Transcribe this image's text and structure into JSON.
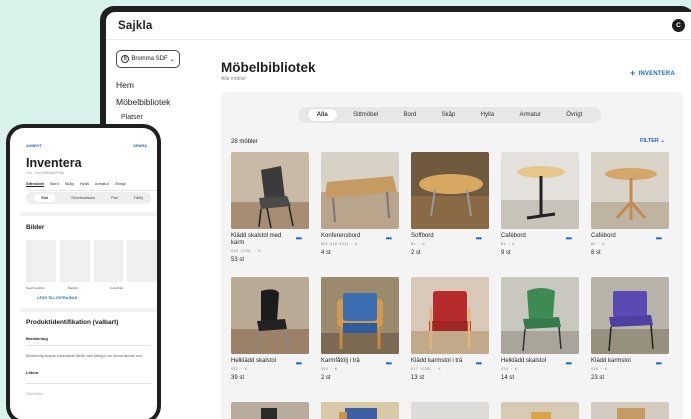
{
  "app": {
    "brand": "Sajkla",
    "avatar_initial": "C"
  },
  "sidebar": {
    "place": "Bromma SDF",
    "place_icon_letter": "B",
    "items": [
      {
        "label": "Hem"
      },
      {
        "label": "Möbelbibliotek"
      },
      {
        "label": "Platser"
      }
    ]
  },
  "main": {
    "title": "Möbelbibliotek",
    "subtitle": "Alla möbler",
    "add_button": "INVENTERA",
    "tabs": [
      "Alla",
      "Sittmöbel",
      "Bord",
      "Skåp",
      "Hylla",
      "Armatur",
      "Övrigt"
    ],
    "active_tab": "Alla",
    "count": "28 möbler",
    "filter": "FILTER"
  },
  "products": [
    {
      "name": "Klädd skalstol med karm",
      "code": "S1S (S29) · K",
      "qty": "53 st"
    },
    {
      "name": "Konferensbord",
      "code": "KO1-416-4311 · K",
      "qty": "4 st"
    },
    {
      "name": "Soffbord",
      "code": "B1 · K",
      "qty": "2 st"
    },
    {
      "name": "Cafébord",
      "code": "B1 · K",
      "qty": "9 st"
    },
    {
      "name": "Cafébord",
      "code": "B1 · K",
      "qty": "8 st"
    },
    {
      "name": "Helklädd skalstol",
      "code": "S52 · K",
      "qty": "39 st"
    },
    {
      "name": "Karmfåtölj i trä",
      "code": "S53 · K",
      "qty": "2 st"
    },
    {
      "name": "Klädd karmstol i trä",
      "code": "S17 (S18) · K",
      "qty": "13 st"
    },
    {
      "name": "Helklädd skalstol",
      "code": "S24 · K",
      "qty": "14 st"
    },
    {
      "name": "Klädd karmstol",
      "code": "S28 · K",
      "qty": "23 st"
    }
  ],
  "phone": {
    "cancel": "AVBRYT",
    "save": "SPARA",
    "title": "Inventera",
    "id": "inv_c5a1906ab09f8a",
    "tabs": [
      "Sittmöbel",
      "Bord",
      "Skåp",
      "Hylla",
      "Armatur",
      "Övrigt"
    ],
    "segments": [
      "Stol",
      "Skrivbordsstol",
      "Pall",
      "Fåtölj"
    ],
    "images_header": "Bilder",
    "image_labels": [
      "Snett framifrån",
      "Bakifrån",
      "Underifrån"
    ],
    "add_image": "LÄGG TILL EXTRA BILD",
    "product_header": "Produktidentifikation (valbart)",
    "naming_label": "Benämning",
    "naming_note": "Benämning skapas automatiskt utifrån vald kategori om denna lämnas tom.",
    "brand_label": "Littera",
    "maker_placeholder": "Tillverkare"
  },
  "colors": {
    "accent": "#1f66c9",
    "background": "#d9f3ec",
    "frame": "#1f1f1f"
  }
}
